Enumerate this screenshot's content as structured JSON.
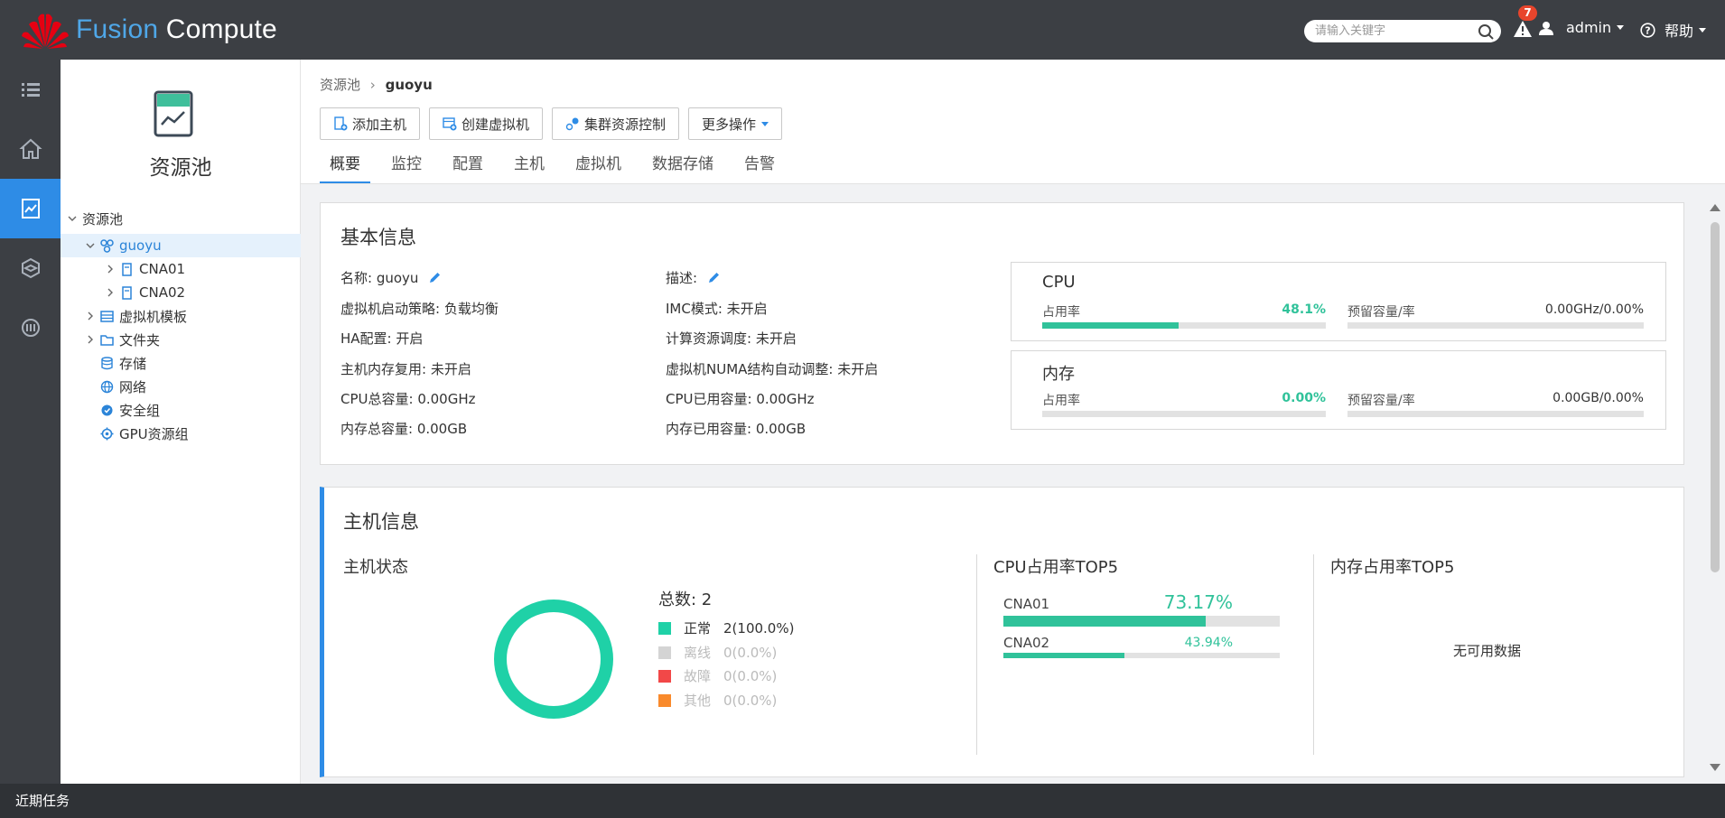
{
  "brand": {
    "name_part1": "Fusion",
    "name_part2": "Compute"
  },
  "header": {
    "search_placeholder": "请输入关键字",
    "alert_count": "7",
    "user": "admin",
    "help": "帮助"
  },
  "rail": {
    "items": [
      {
        "icon": "list-icon",
        "active": false
      },
      {
        "icon": "home-icon",
        "active": false
      },
      {
        "icon": "resource-pool-icon",
        "active": true
      },
      {
        "icon": "network-icon",
        "active": false
      },
      {
        "icon": "datacenter-icon",
        "active": false
      }
    ]
  },
  "tree": {
    "title": "资源池",
    "nodes": [
      {
        "label": "资源池",
        "icon": "",
        "level": 0
      },
      {
        "label": "guoyu",
        "icon": "cluster-icon",
        "level": 1,
        "selected": true
      },
      {
        "label": "CNA01",
        "icon": "host-icon",
        "level": 2
      },
      {
        "label": "CNA02",
        "icon": "host-icon",
        "level": 2
      },
      {
        "label": "虚拟机模板",
        "icon": "template-icon",
        "level": 1
      },
      {
        "label": "文件夹",
        "icon": "folder-icon",
        "level": 1
      },
      {
        "label": "存储",
        "icon": "storage-icon",
        "level": 1
      },
      {
        "label": "网络",
        "icon": "globe-icon",
        "level": 1
      },
      {
        "label": "安全组",
        "icon": "security-group-icon",
        "level": 1
      },
      {
        "label": "GPU资源组",
        "icon": "gpu-icon",
        "level": 1
      }
    ]
  },
  "breadcrumb": {
    "parent": "资源池",
    "current": "guoyu"
  },
  "toolbar": {
    "add_host": "添加主机",
    "create_vm": "创建虚拟机",
    "cluster_control": "集群资源控制",
    "more": "更多操作"
  },
  "tabs": [
    "概要",
    "监控",
    "配置",
    "主机",
    "虚拟机",
    "数据存储",
    "告警"
  ],
  "basic": {
    "title": "基本信息",
    "left": [
      "名称: guoyu",
      "虚拟机启动策略: 负载均衡",
      "HA配置: 开启",
      "主机内存复用: 未开启",
      "CPU总容量: 0.00GHz",
      "内存总容量: 0.00GB"
    ],
    "right": [
      "描述:",
      "IMC模式: 未开启",
      "计算资源调度: 未开启",
      "虚拟机NUMA结构自动调整: 未开启",
      "CPU已用容量: 0.00GHz",
      "内存已用容量: 0.00GB"
    ],
    "cpu": {
      "title": "CPU",
      "usage_label": "占用率",
      "usage": "48.1%",
      "usage_fraction": 0.481,
      "reserve_label": "预留容量/率",
      "reserve": "0.00GHz/0.00%",
      "reserve_fraction": 0
    },
    "mem": {
      "title": "内存",
      "usage_label": "占用率",
      "usage": "0.00%",
      "usage_fraction": 0,
      "reserve_label": "预留容量/率",
      "reserve": "0.00GB/0.00%",
      "reserve_fraction": 0
    }
  },
  "hostinfo": {
    "title": "主机信息",
    "status_title": "主机状态",
    "total": "总数: 2",
    "legend": [
      {
        "name": "正常",
        "value": "2(100.0%)",
        "color": "#1fd1a7",
        "text_color": "#333333"
      },
      {
        "name": "离线",
        "value": "0(0.0%)",
        "color": "#d4d4d4",
        "text_color": "#bbbbbb"
      },
      {
        "name": "故障",
        "value": "0(0.0%)",
        "color": "#f24848",
        "text_color": "#bbbbbb"
      },
      {
        "name": "其他",
        "value": "0(0.0%)",
        "color": "#f98a2c",
        "text_color": "#bbbbbb"
      }
    ],
    "cpu_top_title": "CPU占用率TOP5",
    "cpu_top": [
      {
        "name": "CNA01",
        "pct": "73.17%",
        "fraction": 0.7317
      },
      {
        "name": "CNA02",
        "pct": "43.94%",
        "fraction": 0.4394
      }
    ],
    "mem_top_title": "内存占用率TOP5",
    "mem_nodata": "无可用数据"
  },
  "bottom": {
    "label": "近期任务"
  },
  "colors": {
    "accent": "#2e8ce6",
    "ok": "#30c29a",
    "topbar": "#3c3f44"
  }
}
